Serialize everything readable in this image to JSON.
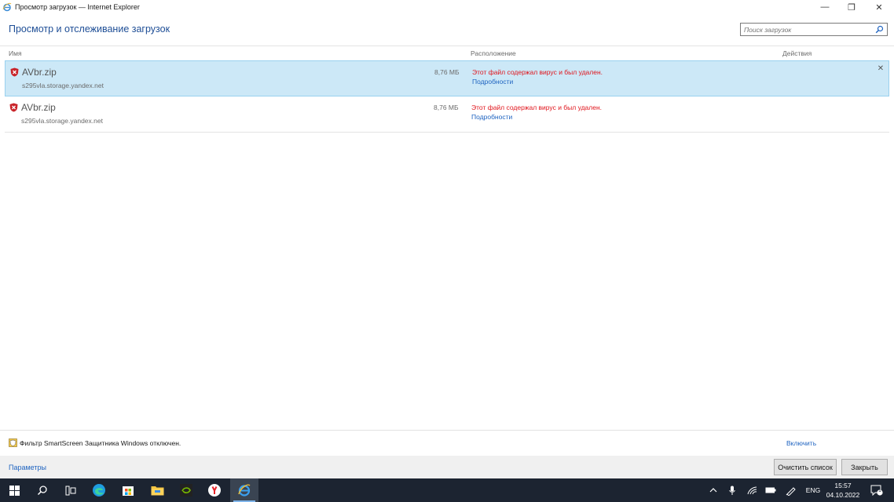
{
  "window": {
    "title": "Просмотр загрузок — Internet Explorer",
    "minimize": "—",
    "maximize": "❐",
    "close": "✕"
  },
  "header": {
    "page_title": "Просмотр и отслеживание загрузок",
    "search_placeholder": "Поиск загрузок"
  },
  "columns": {
    "name": "Имя",
    "location": "Расположение",
    "actions": "Действия"
  },
  "downloads": [
    {
      "filename": "AVbr.zip",
      "host": "s295vla.storage.yandex.net",
      "size": "8,76 МБ",
      "status": "Этот файл содержал вирус и был удален.",
      "details": "Подробности",
      "selected": true,
      "remove": "✕"
    },
    {
      "filename": "AVbr.zip",
      "host": "s295vla.storage.yandex.net",
      "size": "8,76 МБ",
      "status": "Этот файл содержал вирус и был удален.",
      "details": "Подробности",
      "selected": false
    }
  ],
  "smartscreen": {
    "text": "Фильтр SmartScreen Защитника Windows отключен.",
    "enable": "Включить"
  },
  "footer": {
    "options": "Параметры",
    "clear_list": "Очистить список",
    "close": "Закрыть"
  },
  "taskbar": {
    "icons": [
      "windows-start-icon",
      "search-icon",
      "task-view-icon",
      "edge-icon",
      "store-icon",
      "file-explorer-icon",
      "nvidia-icon",
      "yandex-browser-icon",
      "internet-explorer-icon"
    ],
    "language": "ENG",
    "time": "15:57",
    "date": "04.10.2022",
    "notification_count": "1"
  },
  "colors": {
    "accent_title": "#1e4e96",
    "link": "#1e63c0",
    "error": "#e0151c",
    "selection": "#cce8f7",
    "taskbar": "#1c2431"
  }
}
